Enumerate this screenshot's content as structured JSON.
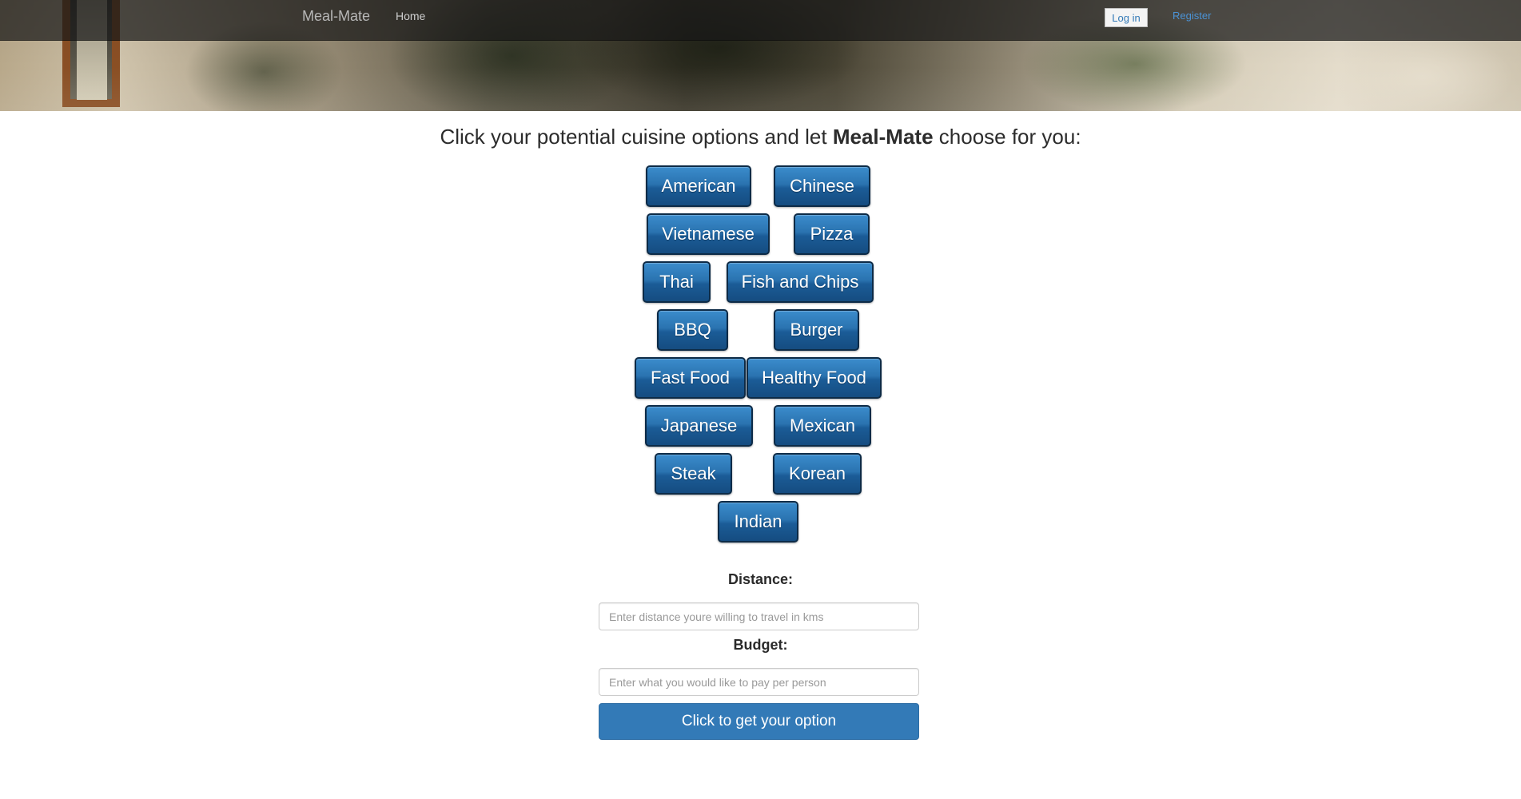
{
  "navbar": {
    "brand": "Meal-Mate",
    "home_label": "Home",
    "login_label": "Log in",
    "register_label": "Register"
  },
  "main": {
    "headline_prefix": "Click your potential cuisine options and let ",
    "headline_brand": "Meal-Mate",
    "headline_suffix": " choose for you:",
    "cuisines": [
      "American",
      "Chinese",
      "Vietnamese",
      "Pizza",
      "Thai",
      "Fish and Chips",
      "BBQ",
      "Burger",
      "Fast Food",
      "Healthy Food",
      "Japanese",
      "Mexican",
      "Steak",
      "Korean",
      "Indian"
    ],
    "distance": {
      "label": "Distance:",
      "placeholder": "Enter distance youre willing to travel in kms",
      "value": ""
    },
    "budget": {
      "label": "Budget:",
      "placeholder": "Enter what you would like to pay per person",
      "value": ""
    },
    "submit_label": "Click to get your option"
  },
  "colors": {
    "navbar_bg": "#181818",
    "cuisine_button": "#1b5c97",
    "cuisine_border": "#0d2b47",
    "submit_button": "#337ab7",
    "link": "#4b93d6"
  }
}
